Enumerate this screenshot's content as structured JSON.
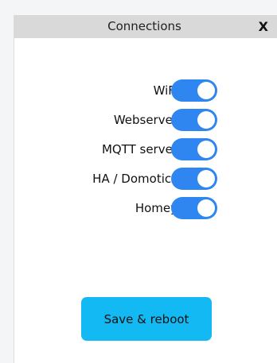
{
  "dialog": {
    "title": "Connections",
    "close_label": "X"
  },
  "toggles": [
    {
      "label": "WiFi",
      "on": true
    },
    {
      "label": "Webserver",
      "on": true
    },
    {
      "label": "MQTT server",
      "on": true
    },
    {
      "label": "HA / Domoticz",
      "on": true
    },
    {
      "label": "Homey",
      "on": true
    }
  ],
  "save_button": {
    "label": "Save & reboot"
  },
  "colors": {
    "toggle_on": "#2f86f0",
    "save_button": "#12b9f3",
    "titlebar": "#d9d9d9"
  }
}
